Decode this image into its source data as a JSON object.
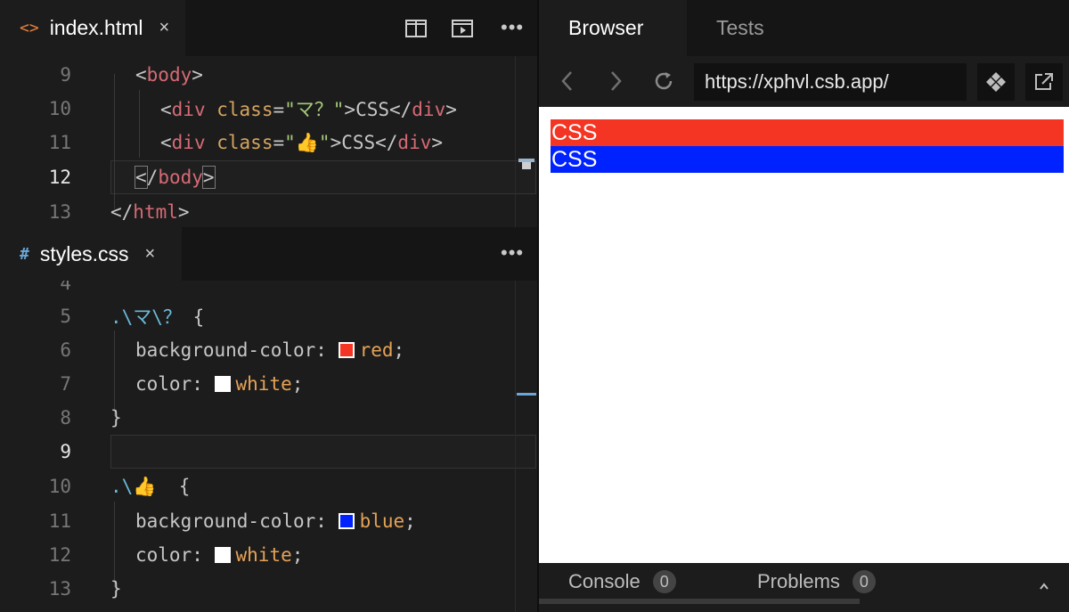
{
  "html_tab": {
    "icon": "<>",
    "filename": "index.html",
    "close": "×"
  },
  "css_tab": {
    "icon": "#",
    "filename": "styles.css",
    "close": "×"
  },
  "more_label": "•••",
  "html_editor": {
    "line_numbers": [
      "9",
      "10",
      "11",
      "12",
      "13"
    ],
    "lines": {
      "l9": [
        "<",
        "body",
        ">"
      ],
      "l10": [
        "<",
        "div",
        " ",
        "class",
        "=",
        "\"マ？\"",
        ">CSS</",
        "div",
        ">"
      ],
      "l11": [
        "<",
        "div",
        " ",
        "class",
        "=",
        "\"👍\"",
        ">CSS</",
        "div",
        ">"
      ],
      "l12": [
        "<",
        "/",
        "body",
        ">"
      ],
      "l13": [
        "</",
        "html",
        ">"
      ]
    }
  },
  "css_editor": {
    "line_numbers": [
      "4",
      "5",
      "6",
      "7",
      "8",
      "9",
      "10",
      "11",
      "12",
      "13"
    ],
    "rule1_selector": ".\\マ\\？",
    "rule1_brace": " {",
    "rule1_prop1": "background-color:",
    "rule1_val1": "red",
    "rule1_prop2": "color:",
    "rule1_val2": "white",
    "close_brace": "}",
    "rule2_selector_prefix": ".\\",
    "rule2_selector_emoji": "👍",
    "rule2_brace": "  {",
    "rule2_prop1": "background-color:",
    "rule2_val1": "blue",
    "rule2_prop2": "color:",
    "rule2_val2": "white",
    "semicolon": ";"
  },
  "browser": {
    "tabs": [
      "Browser",
      "Tests"
    ],
    "url": "https://xphvl.csb.app/",
    "preview_boxes": [
      {
        "text": "CSS",
        "bg": "#f53523"
      },
      {
        "text": "CSS",
        "bg": "#0022ff"
      }
    ]
  },
  "bottom": {
    "console_label": "Console",
    "console_count": "0",
    "problems_label": "Problems",
    "problems_count": "0"
  },
  "colors": {
    "accent_orange": "#e8803a",
    "css_hash_blue": "#6aa7d8",
    "swatch_red": "#f53523",
    "swatch_blue": "#0022ff",
    "swatch_white": "#ffffff"
  },
  "icons": {
    "html_file": "code-brackets-icon",
    "css_file": "hash-icon",
    "split_view": "split-view-icon",
    "preview": "preview-icon",
    "back": "chevron-left-icon",
    "forward": "chevron-right-icon",
    "refresh": "refresh-icon",
    "devtools": "diamond-grid-icon",
    "open_new": "external-link-icon"
  }
}
